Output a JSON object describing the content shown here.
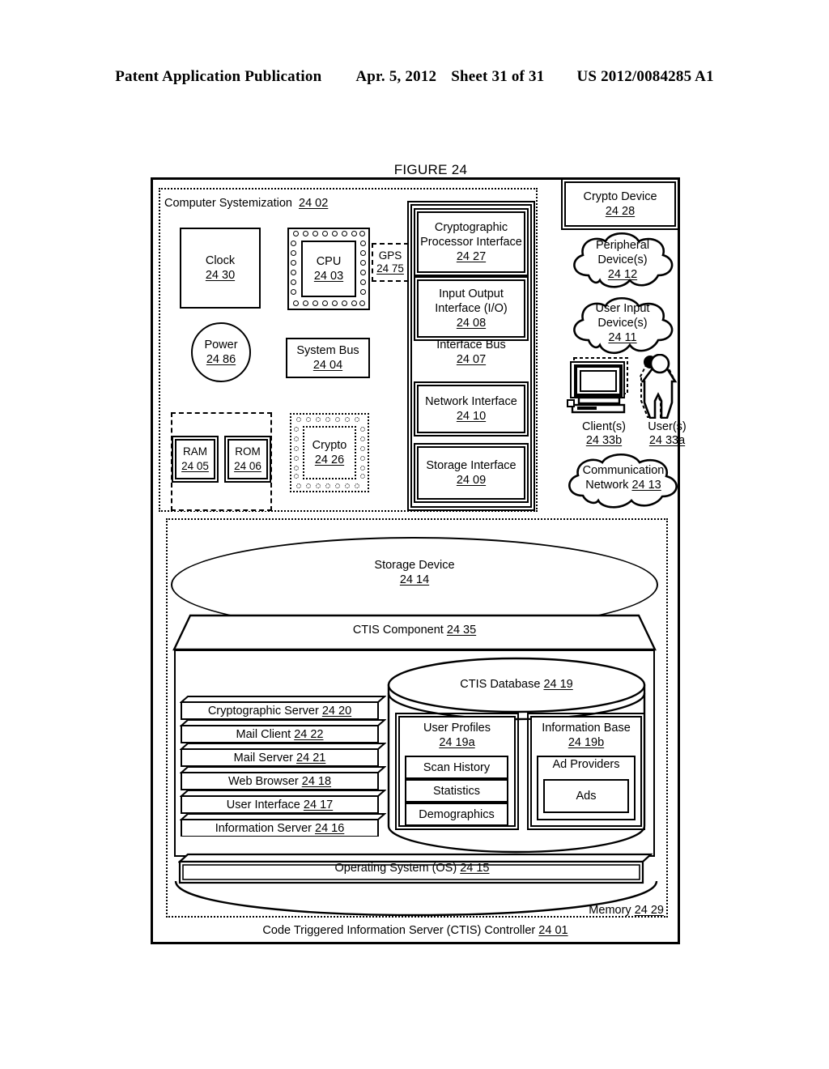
{
  "header": {
    "publication": "Patent Application Publication",
    "date": "Apr. 5, 2012",
    "sheet": "Sheet 31 of 31",
    "docnum": "US 2012/0084285 A1"
  },
  "figure": {
    "title": "FIGURE 24"
  },
  "diagram": {
    "controller": {
      "label": "Code Triggered Information Server (CTIS) Controller",
      "ref": "24 01"
    },
    "computer_systemization": {
      "label": "Computer Systemization",
      "ref": "24 02"
    },
    "memory": {
      "label": "Memory",
      "ref": "24 29"
    },
    "clock": {
      "label": "Clock",
      "ref": "24 30"
    },
    "cpu": {
      "label": "CPU",
      "ref": "24 03"
    },
    "gps": {
      "label": "GPS",
      "ref": "24 75"
    },
    "power": {
      "label": "Power",
      "ref": "24 86"
    },
    "system_bus": {
      "label": "System Bus",
      "ref": "24 04"
    },
    "ram": {
      "label": "RAM",
      "ref": "24 05"
    },
    "rom": {
      "label": "ROM",
      "ref": "24 06"
    },
    "crypto": {
      "label": "Crypto",
      "ref": "24 26"
    },
    "interface_bus": {
      "label": "Interface Bus",
      "ref": "24 07"
    },
    "crypto_processor_interface": {
      "label1": "Cryptographic",
      "label2": "Processor Interface",
      "ref": "24 27"
    },
    "io_interface": {
      "label1": "Input Output",
      "label2": "Interface (I/O)",
      "ref": "24 08"
    },
    "network_interface": {
      "label": "Network Interface",
      "ref": "24 10"
    },
    "storage_interface": {
      "label": "Storage Interface",
      "ref": "24 09"
    },
    "crypto_device": {
      "label": "Crypto Device",
      "ref": "24 28"
    },
    "peripheral_devices": {
      "label1": "Peripheral",
      "label2": "Device(s)",
      "ref": "24 12"
    },
    "user_input_devices": {
      "label1": "User Input",
      "label2": "Device(s)",
      "ref": "24 11"
    },
    "clients": {
      "label": "Client(s)",
      "ref": "24 33b"
    },
    "users": {
      "label": "User(s)",
      "ref": "24 33a"
    },
    "communication_network": {
      "label1": "Communication",
      "label2": "Network",
      "ref": "24 13"
    },
    "storage_device": {
      "label": "Storage Device",
      "ref": "24 14"
    },
    "ctis_component": {
      "label": "CTIS Component",
      "ref": "24 35"
    },
    "ctis_database": {
      "label": "CTIS Database",
      "ref": "24 19"
    },
    "operating_system": {
      "label": "Operating System (OS)",
      "ref": "24 15"
    },
    "servers": [
      {
        "label": "Cryptographic Server",
        "ref": "24 20"
      },
      {
        "label": "Mail Client",
        "ref": "24 22"
      },
      {
        "label": "Mail Server",
        "ref": "24 21"
      },
      {
        "label": "Web Browser",
        "ref": "24 18"
      },
      {
        "label": "User Interface",
        "ref": "24 17"
      },
      {
        "label": "Information Server",
        "ref": "24 16"
      }
    ],
    "user_profiles": {
      "label": "User Profiles",
      "ref": "24 19a",
      "items": [
        "Scan History",
        "Statistics",
        "Demographics"
      ]
    },
    "information_base": {
      "label": "Information Base",
      "ref": "24 19b",
      "provider_label": "Ad Providers",
      "ads_label": "Ads"
    }
  }
}
